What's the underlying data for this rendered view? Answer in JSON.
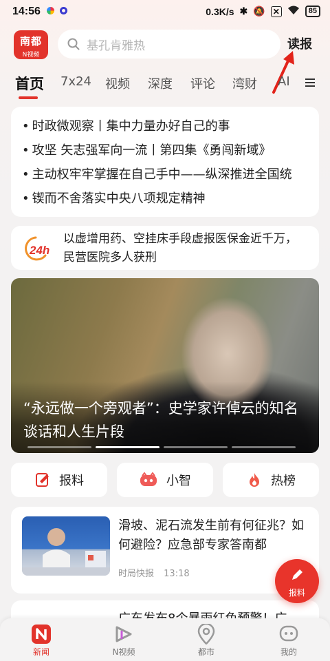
{
  "status_bar": {
    "time": "14:56",
    "network_speed": "0.3K/s",
    "battery": "85"
  },
  "header": {
    "logo_line1": "南都",
    "logo_line2": "N视频",
    "search_placeholder": "基孔肯雅热",
    "read_news_label": "读报"
  },
  "tabs": [
    {
      "label": "首页",
      "active": true
    },
    {
      "label": "7x24"
    },
    {
      "label": "视频"
    },
    {
      "label": "深度"
    },
    {
      "label": "评论"
    },
    {
      "label": "湾财"
    },
    {
      "label": "AI"
    }
  ],
  "headlines": [
    "时政微观察丨集中力量办好自己的事",
    "攻坚 矢志强军向一流丨第四集《勇闯新域》",
    "主动权牢牢掌握在自己手中——纵深推进全国统",
    "锲而不舍落实中央八项规定精神"
  ],
  "news24": {
    "badge": "24h",
    "text": "以虚增用药、空挂床手段虚报医保金近千万，民营医院多人获刑"
  },
  "hero": {
    "title": "“永远做一个旁观者”：史学家许倬云的知名谈话和人生片段"
  },
  "quick_actions": [
    {
      "label": "报料",
      "icon": "report-icon"
    },
    {
      "label": "小智",
      "icon": "assistant-icon"
    },
    {
      "label": "热榜",
      "icon": "fire-icon"
    }
  ],
  "news_items": [
    {
      "title": "滑坡、泥石流发生前有何征兆？如何避险？应急部专家答南都",
      "source": "时局快报",
      "time": "13:18"
    },
    {
      "title": "广东发布8个暴雨红色预警！广"
    }
  ],
  "fab_label": "报料",
  "bottom_nav": [
    {
      "label": "新闻",
      "active": true
    },
    {
      "label": "N视频"
    },
    {
      "label": "都市"
    },
    {
      "label": "我的"
    }
  ],
  "colors": {
    "brand": "#e2332b",
    "text": "#222222",
    "muted": "#999999"
  }
}
